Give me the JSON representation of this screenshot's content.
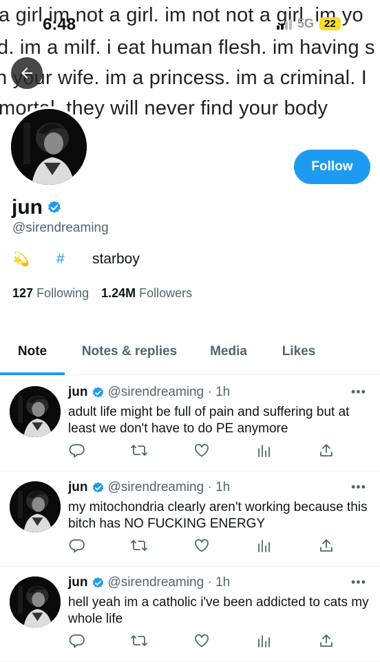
{
  "status_bar": {
    "time": "6:48",
    "network": "5G",
    "battery": "22"
  },
  "banner": {
    "lines": [
      "a girl im not a girl. im not not a girl. im yo",
      "d. im a milf. i eat human flesh. im having s",
      "h your wife. im a princess. im a criminal. I",
      "mortal. they will never find your body"
    ]
  },
  "profile": {
    "name": "jun",
    "handle": "@sirendreaming",
    "bio_emoji": "💫",
    "bio_hash": "#",
    "bio_text": "starboy",
    "following_count": "127",
    "following_label": "Following",
    "followers_count": "1.24M",
    "followers_label": "Followers",
    "follow_label": "Follow",
    "accent_color": "#1d9bf0"
  },
  "tabs": [
    {
      "label": "Note",
      "active": true
    },
    {
      "label": "Notes & replies",
      "active": false
    },
    {
      "label": "Media",
      "active": false
    },
    {
      "label": "Likes",
      "active": false
    }
  ],
  "tweets": [
    {
      "name": "jun",
      "meta": "@sirendreaming · 1h",
      "text": "adult life might be full of pain and suffering but at least we don't have to do PE anymore"
    },
    {
      "name": "jun",
      "meta": "@sirendreaming · 1h",
      "text": "my mitochondria clearly aren't working because this bitch has NO FUCKING ENERGY"
    },
    {
      "name": "jun",
      "meta": "@sirendreaming · 1h",
      "text": "hell yeah im a catholic i've been addicted to cats my whole life"
    }
  ],
  "more_label": "•••",
  "icons": {
    "back": "arrow-left-icon",
    "verified": "verified-badge-icon",
    "reply": "reply-icon",
    "retweet": "retweet-icon",
    "like": "heart-icon",
    "views": "analytics-icon",
    "share": "share-icon"
  }
}
